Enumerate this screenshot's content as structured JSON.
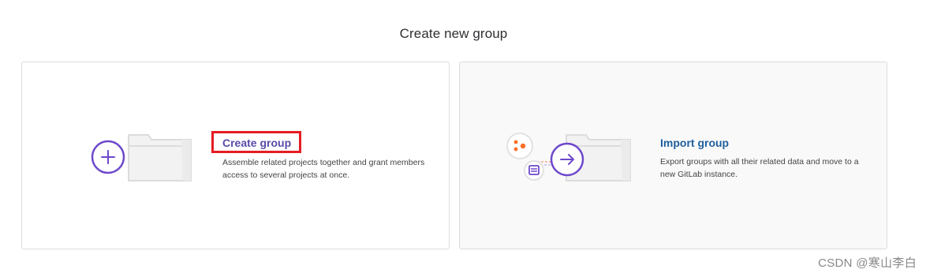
{
  "page": {
    "title": "Create new group"
  },
  "cards": {
    "create": {
      "title": "Create group",
      "description": "Assemble related projects together and grant members access to several projects at once."
    },
    "import": {
      "title": "Import group",
      "description": "Export groups with all their related data and move to a new GitLab instance."
    }
  },
  "icons": {
    "create_icon": "plus-icon",
    "import_icon": "arrow-right-icon",
    "folder_icon": "folder-icon",
    "source_icons": [
      "gitlab-nodes-icon",
      "document-stack-icon"
    ]
  },
  "colors": {
    "accent_purple": "#6e49cb",
    "create_link": "#5b4aa8",
    "import_link": "#1f5f9c",
    "highlight_border": "#e51c23",
    "orange": "#fc6d26"
  },
  "watermark": {
    "text": "CSDN @寒山李白"
  }
}
